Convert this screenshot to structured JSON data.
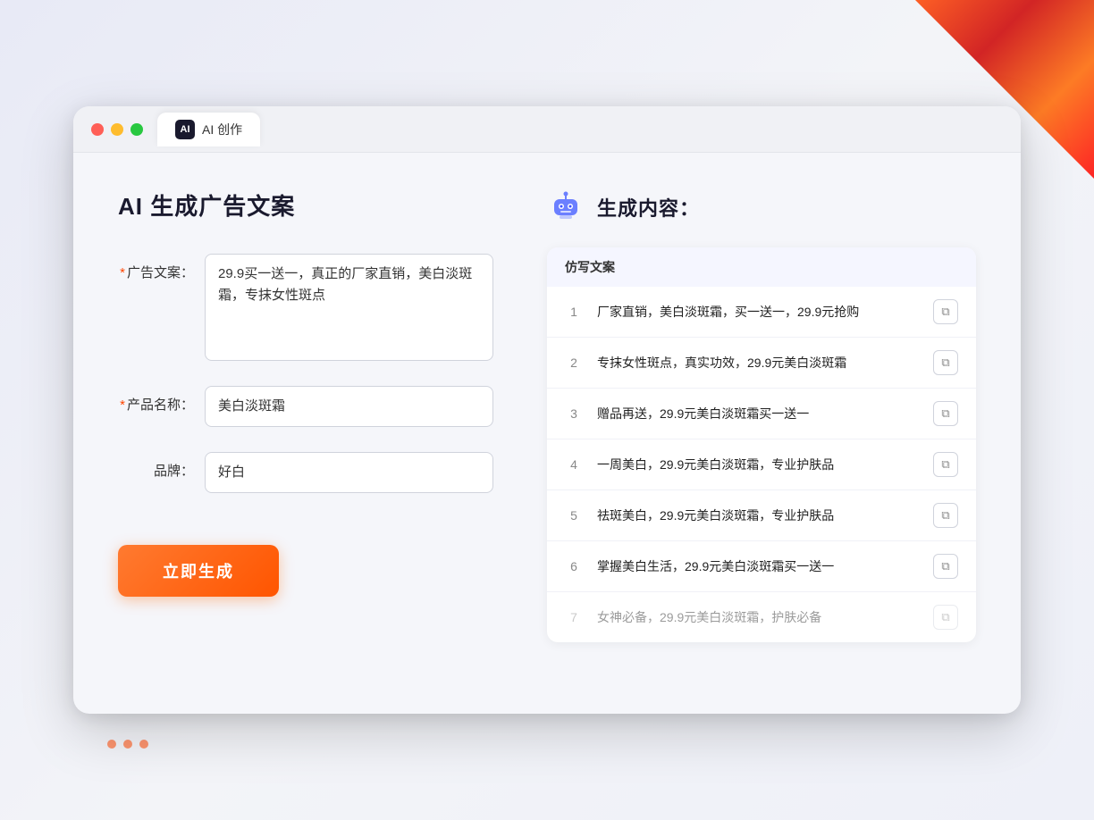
{
  "window": {
    "tab_label": "AI 创作",
    "tab_icon": "AI"
  },
  "left_panel": {
    "page_title": "AI 生成广告文案",
    "fields": [
      {
        "label": "广告文案：",
        "required": true,
        "type": "textarea",
        "value": "29.9买一送一，真正的厂家直销，美白淡斑霜，专抹女性斑点",
        "name": "ad-copy-field"
      },
      {
        "label": "产品名称：",
        "required": true,
        "type": "input",
        "value": "美白淡斑霜",
        "name": "product-name-field"
      },
      {
        "label": "品牌：",
        "required": false,
        "type": "input",
        "value": "好白",
        "name": "brand-field"
      }
    ],
    "generate_button": "立即生成"
  },
  "right_panel": {
    "title": "生成内容：",
    "table_header": "仿写文案",
    "results": [
      {
        "num": 1,
        "text": "厂家直销，美白淡斑霜，买一送一，29.9元抢购",
        "muted": false
      },
      {
        "num": 2,
        "text": "专抹女性斑点，真实功效，29.9元美白淡斑霜",
        "muted": false
      },
      {
        "num": 3,
        "text": "赠品再送，29.9元美白淡斑霜买一送一",
        "muted": false
      },
      {
        "num": 4,
        "text": "一周美白，29.9元美白淡斑霜，专业护肤品",
        "muted": false
      },
      {
        "num": 5,
        "text": "祛斑美白，29.9元美白淡斑霜，专业护肤品",
        "muted": false
      },
      {
        "num": 6,
        "text": "掌握美白生活，29.9元美白淡斑霜买一送一",
        "muted": false
      },
      {
        "num": 7,
        "text": "女神必备，29.9元美白淡斑霜，护肤必备",
        "muted": true
      }
    ]
  },
  "colors": {
    "accent_orange": "#ff5500",
    "accent_blue": "#6b7fff",
    "required_red": "#ff4500"
  }
}
